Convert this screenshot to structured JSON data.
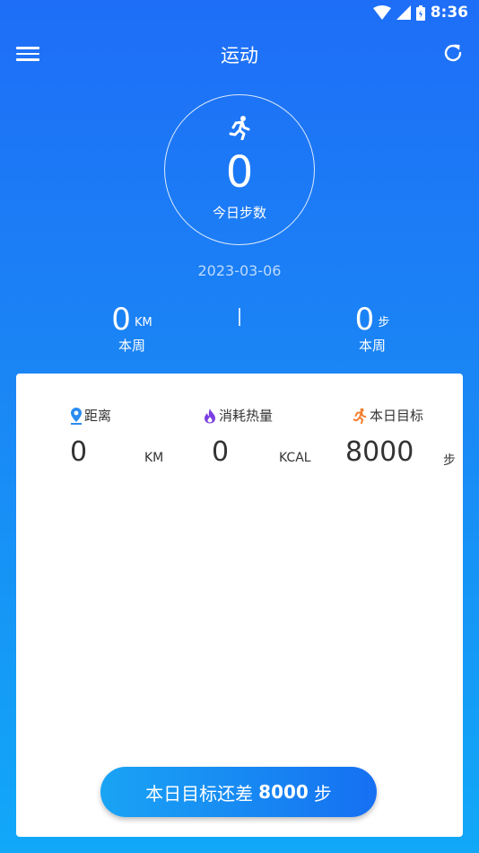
{
  "status_bar": {
    "time": "8:36"
  },
  "header": {
    "title": "运动"
  },
  "today": {
    "steps": "0",
    "label": "今日步数",
    "date": "2023-03-06"
  },
  "week": {
    "distance": {
      "value": "0",
      "unit": "KM",
      "label": "本周"
    },
    "steps": {
      "value": "0",
      "unit": "步",
      "label": "本周"
    }
  },
  "stats": [
    {
      "label": "距离",
      "value": "0",
      "unit": "KM",
      "icon": "location-pin-icon",
      "color": "#2a8cf0"
    },
    {
      "label": "消耗热量",
      "value": "0",
      "unit": "KCAL",
      "icon": "flame-icon",
      "color": "#7b3fe4"
    },
    {
      "label": "本日目标",
      "value": "8000",
      "unit": "步",
      "icon": "runner-icon",
      "color": "#f57c2a"
    }
  ],
  "goal_button": {
    "prefix": "本日目标还差",
    "number": "8000",
    "suffix": "步"
  },
  "colors": {
    "bg_top": "#1e6ef7",
    "bg_bottom": "#11a8f8",
    "button_start": "#19a4f4",
    "button_end": "#1670f2"
  }
}
